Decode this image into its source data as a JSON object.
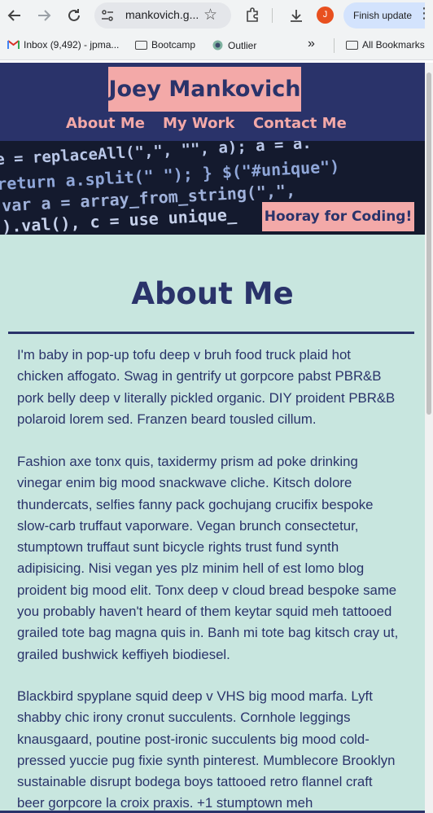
{
  "browser": {
    "url": "mankovich.g...",
    "finish_update": "Finish update",
    "profile_initial": "J",
    "bookmarks": [
      {
        "label": "Inbox (9,492) - jpma..."
      },
      {
        "label": "Bootcamp"
      },
      {
        "label": "Outlier"
      }
    ],
    "overflow": "»",
    "all_bookmarks": "All Bookmarks"
  },
  "site": {
    "name": "Joey Mankovich",
    "nav": [
      "About Me",
      "My Work",
      "Contact Me"
    ],
    "hero_text": "Hooray for Coding!",
    "hero_code": [
      "e = replaceAll(\",\", \"\", a); a = a.",
      "return a.split(\" \"); } $(\"#unique\")",
      "var a = array_from_string(\",\",",
      "\").val(), c = use unique_"
    ]
  },
  "about": {
    "title": "About Me",
    "paragraphs": [
      "I'm baby in pop-up tofu deep v bruh food truck plaid hot chicken affogato. Swag in gentrify ut gorpcore pabst PBR&B pork belly deep v literally pickled organic. DIY proident PBR&B polaroid lorem sed. Franzen beard tousled cillum.",
      "Fashion axe tonx quis, taxidermy prism ad poke drinking vinegar enim big mood snackwave cliche. Kitsch dolore thundercats, selfies fanny pack gochujang crucifix bespoke slow-carb truffaut vaporware. Vegan brunch consectetur, stumptown truffaut sunt bicycle rights trust fund synth adipisicing. Nisi vegan yes plz minim hell of est lomo blog proident big mood elit. Tonx deep v cloud bread bespoke same you probably haven't heard of them keytar squid meh tattooed grailed tote bag magna quis in. Banh mi tote bag kitsch cray ut, grailed bushwick keffiyeh biodiesel.",
      "Blackbird spyplane squid deep v VHS big mood marfa. Lyft shabby chic irony cronut succulents. Cornhole leggings knausgaard, poutine post-ironic succulents big mood cold-pressed yuccie pug fixie synth pinterest. Mumblecore Brooklyn sustainable disrupt bodega boys tattooed retro flannel craft beer gorpcore la croix praxis. +1 stumptown meh"
    ]
  },
  "colors": {
    "navy": "#2a336a",
    "pink": "#f3a9a8",
    "mint": "#c8e6df"
  }
}
